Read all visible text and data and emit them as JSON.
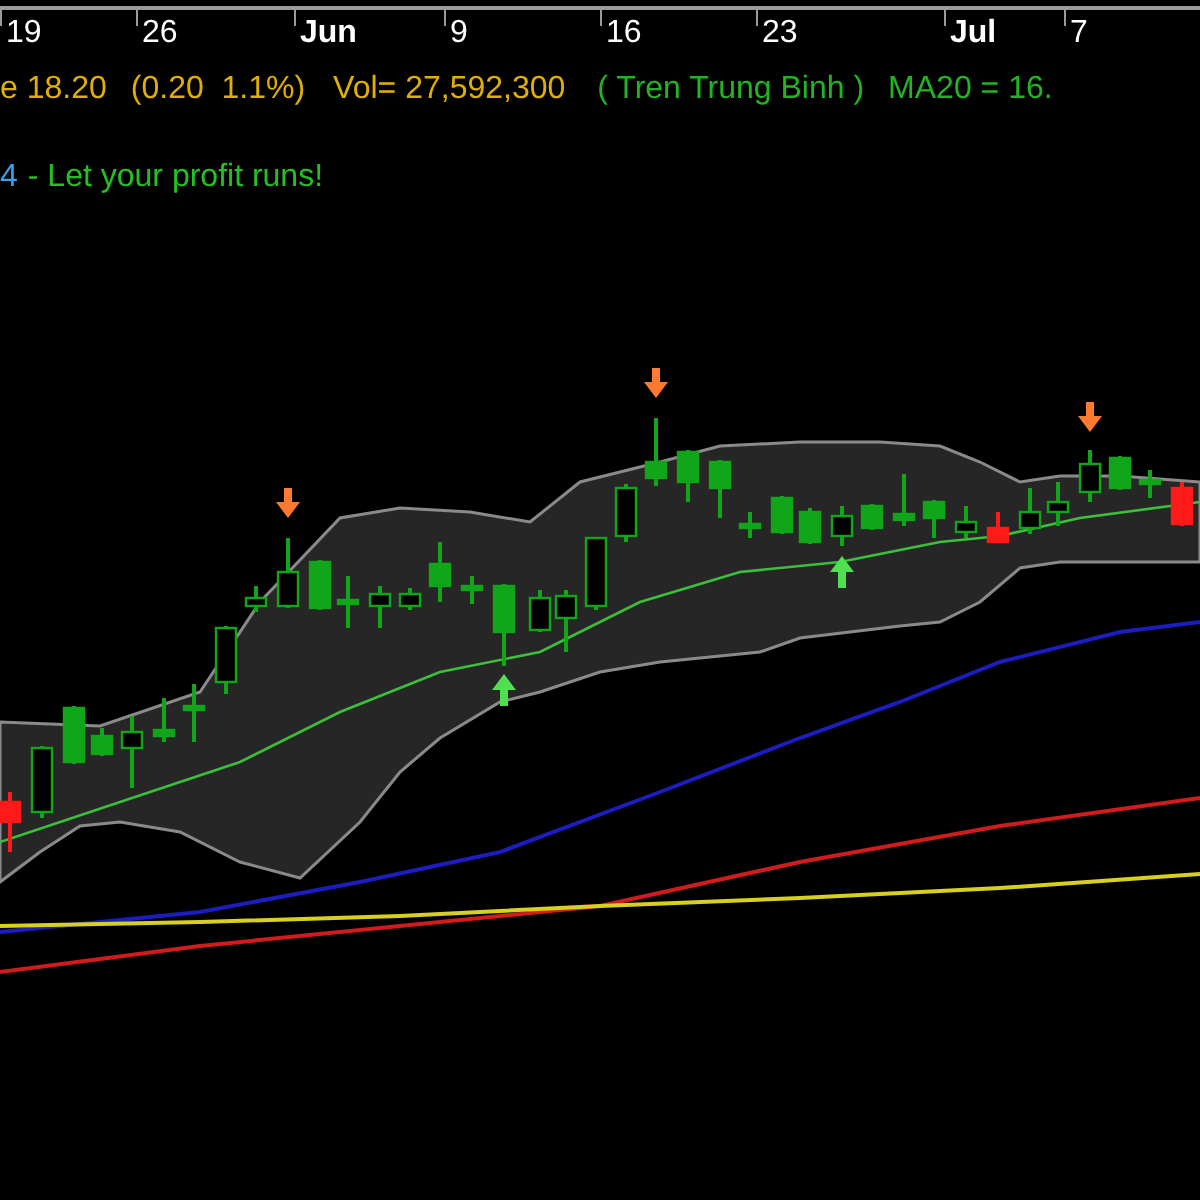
{
  "time_axis": {
    "ticks": [
      {
        "label": "19",
        "kind": "day"
      },
      {
        "label": "26",
        "kind": "day"
      },
      {
        "label": "Jun",
        "kind": "month"
      },
      {
        "label": "9",
        "kind": "day"
      },
      {
        "label": "16",
        "kind": "day"
      },
      {
        "label": "23",
        "kind": "day"
      },
      {
        "label": "Jul",
        "kind": "month"
      },
      {
        "label": "7",
        "kind": "day"
      }
    ]
  },
  "quote_line": {
    "price": "e 18.20",
    "change": "(0.20  1.1%)",
    "volume": "Vol= 27,592,300",
    "trend": "( Tren Trung Binh )",
    "ma": "MA20 = 16."
  },
  "slogan": {
    "number": "4",
    "text": "- Let your profit runs!"
  }
}
